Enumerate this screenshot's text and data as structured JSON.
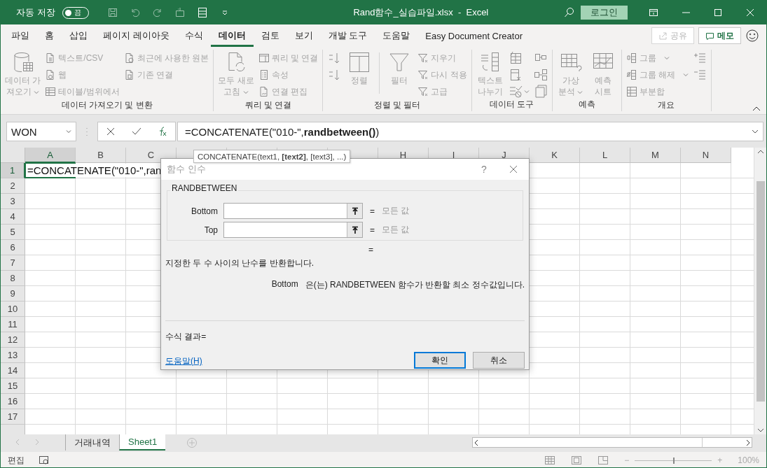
{
  "title_bar": {
    "autosave_label": "자동 저장",
    "autosave_state": "끔",
    "autosave_on": false,
    "file_title": "Rand함수_실습파일.xlsx  -  Excel",
    "login": "로그인"
  },
  "menu_tabs": [
    {
      "label": "파일",
      "selected": false
    },
    {
      "label": "홈",
      "selected": false
    },
    {
      "label": "삽입",
      "selected": false
    },
    {
      "label": "페이지 레이아웃",
      "selected": false
    },
    {
      "label": "수식",
      "selected": false
    },
    {
      "label": "데이터",
      "selected": true
    },
    {
      "label": "검토",
      "selected": false
    },
    {
      "label": "보기",
      "selected": false
    },
    {
      "label": "개발 도구",
      "selected": false
    },
    {
      "label": "도움말",
      "selected": false
    },
    {
      "label": "Easy Document Creator",
      "selected": false
    }
  ],
  "share": {
    "label": "공유",
    "disabled": true
  },
  "memo": {
    "label": "메모"
  },
  "ribbon": {
    "disabled": true,
    "groups": [
      {
        "title": "데이터 가져오기 및 변환",
        "columns": [
          {
            "kind": "large",
            "items": [
              {
                "label": "데이터 가\n져오기",
                "dropdown": true
              }
            ]
          },
          {
            "kind": "small",
            "items": [
              {
                "label": "텍스트/CSV",
                "dropdown": false
              },
              {
                "label": "웹",
                "dropdown": false
              },
              {
                "label": "테이블/범위에서",
                "dropdown": false
              }
            ]
          },
          {
            "kind": "small",
            "items": [
              {
                "label": "최근에 사용한 원본",
                "dropdown": false
              },
              {
                "label": "기존 연결",
                "dropdown": false
              }
            ]
          }
        ]
      },
      {
        "title": "쿼리 및 연결",
        "columns": [
          {
            "kind": "large",
            "items": [
              {
                "label": "모두 새로\n고침",
                "dropdown": true
              }
            ]
          },
          {
            "kind": "small",
            "items": [
              {
                "label": "쿼리 및 연결",
                "dropdown": false
              },
              {
                "label": "속성",
                "dropdown": false
              },
              {
                "label": "연결 편집",
                "dropdown": false
              }
            ]
          }
        ]
      },
      {
        "title": "정렬 및 필터",
        "columns": [
          {
            "kind": "icons",
            "items": [
              {
                "dropdown": false
              },
              {
                "dropdown": false
              }
            ]
          },
          {
            "kind": "large",
            "items": [
              {
                "label": "정렬",
                "dropdown": false
              }
            ]
          },
          {
            "kind": "separator"
          },
          {
            "kind": "large",
            "items": [
              {
                "label": "필터",
                "dropdown": false
              }
            ]
          },
          {
            "kind": "small",
            "items": [
              {
                "label": "지우기",
                "dropdown": false
              },
              {
                "label": "다시 적용",
                "dropdown": false
              },
              {
                "label": "고급",
                "dropdown": false
              }
            ]
          }
        ]
      },
      {
        "title": "데이터 도구",
        "columns": [
          {
            "kind": "large",
            "items": [
              {
                "label": "텍스트\n나누기",
                "dropdown": false
              }
            ]
          },
          {
            "kind": "icons",
            "items": [
              {
                "dropdown": false
              },
              {
                "dropdown": false
              },
              {
                "dropdown": true
              }
            ]
          },
          {
            "kind": "icons",
            "items": [
              {
                "dropdown": false
              },
              {
                "dropdown": false
              },
              {
                "dropdown": false
              }
            ]
          }
        ]
      },
      {
        "title": "예측",
        "columns": [
          {
            "kind": "large",
            "items": [
              {
                "label": "가상\n분석",
                "dropdown": true
              }
            ]
          },
          {
            "kind": "large",
            "items": [
              {
                "label": "예측\n시트",
                "dropdown": false
              }
            ]
          }
        ]
      },
      {
        "title": "개요",
        "columns": [
          {
            "kind": "small",
            "items": [
              {
                "label": "그룹",
                "dropdown": true
              },
              {
                "label": "그룹 해제",
                "dropdown": true
              },
              {
                "label": "부분합",
                "dropdown": false
              }
            ]
          },
          {
            "kind": "icons",
            "items": [
              {
                "dropdown": false
              },
              {
                "dropdown": false
              }
            ]
          }
        ]
      }
    ]
  },
  "formula_bar": {
    "name_box": "WON",
    "formula": "=CONCATENATE(\"010-\",**randbetween()**)"
  },
  "tooltip": "CONCATENATE(text1, **[text2]**, [text3], ...)",
  "grid": {
    "columns": [
      {
        "label": "A",
        "selected": true
      },
      {
        "label": "B",
        "selected": false
      },
      {
        "label": "C",
        "selected": false
      },
      {
        "selected": false
      },
      {
        "selected": false
      },
      {
        "selected": false
      },
      {
        "selected": false
      },
      {
        "label": "H",
        "selected": false
      },
      {
        "label": "I",
        "selected": false
      },
      {
        "label": "J",
        "selected": false
      },
      {
        "label": "K",
        "selected": false
      },
      {
        "label": "L",
        "selected": false
      },
      {
        "label": "M",
        "selected": false
      },
      {
        "label": "N",
        "selected": false
      }
    ],
    "rows": [
      {
        "label": "1",
        "selected": true,
        "cell": "=CONCATENATE(\"010-\",ran"
      },
      {
        "label": "2",
        "selected": false
      },
      {
        "label": "3",
        "selected": false
      },
      {
        "label": "4",
        "selected": false
      },
      {
        "label": "5",
        "selected": false
      },
      {
        "label": "6",
        "selected": false
      },
      {
        "label": "7",
        "selected": false
      },
      {
        "label": "8",
        "selected": false
      },
      {
        "label": "9",
        "selected": false
      },
      {
        "label": "10",
        "selected": false
      },
      {
        "label": "11",
        "selected": false
      },
      {
        "label": "12",
        "selected": false
      },
      {
        "label": "13",
        "selected": false
      },
      {
        "label": "14",
        "selected": false
      },
      {
        "label": "15",
        "selected": false
      },
      {
        "label": "16",
        "selected": false
      },
      {
        "label": "17",
        "selected": false
      }
    ]
  },
  "dialog": {
    "title": "함수 인수",
    "help_mark": "?",
    "function_name": "RANDBETWEEN",
    "arguments": [
      {
        "label": "Bottom",
        "equals": "=",
        "hint": "모든 값"
      },
      {
        "label": "Top",
        "equals": "=",
        "hint": "모든 값"
      }
    ],
    "result_equals": "=",
    "description": "지정한 두 수 사이의 난수를 반환합니다.",
    "arg_name": "Bottom",
    "arg_help": "은(는) RANDBETWEEN 함수가 반환할 최소 정수값입니다.",
    "formula_result": "수식 결과=",
    "help_link": "도움말(H)",
    "buttons": [
      {
        "label": "확인",
        "default": true
      },
      {
        "label": "취소",
        "default": false
      }
    ]
  },
  "sheet_tabs": [
    {
      "label": "거래내역",
      "selected": false
    },
    {
      "label": "Sheet1",
      "selected": true
    }
  ],
  "status_bar": {
    "mode": "편집",
    "zoom_minus": "−",
    "zoom_plus": "+",
    "zoom": "100%",
    "zoom_level": {
      "level": 0.5
    }
  }
}
